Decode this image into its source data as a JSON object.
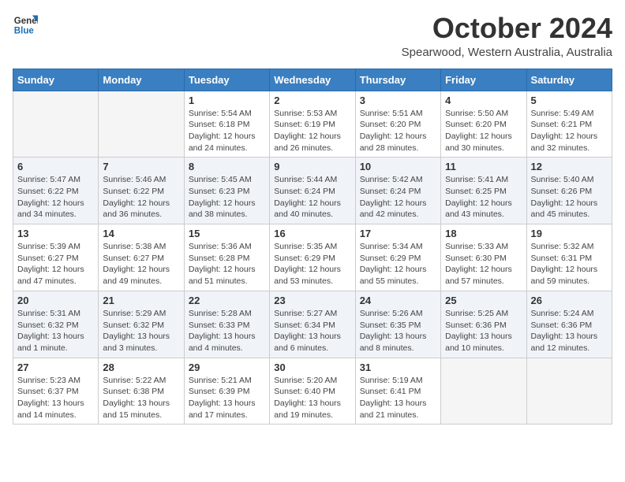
{
  "logo": {
    "line1": "General",
    "line2": "Blue"
  },
  "title": "October 2024",
  "subtitle": "Spearwood, Western Australia, Australia",
  "days_of_week": [
    "Sunday",
    "Monday",
    "Tuesday",
    "Wednesday",
    "Thursday",
    "Friday",
    "Saturday"
  ],
  "weeks": [
    [
      {
        "num": "",
        "info": ""
      },
      {
        "num": "",
        "info": ""
      },
      {
        "num": "1",
        "info": "Sunrise: 5:54 AM\nSunset: 6:18 PM\nDaylight: 12 hours and 24 minutes."
      },
      {
        "num": "2",
        "info": "Sunrise: 5:53 AM\nSunset: 6:19 PM\nDaylight: 12 hours and 26 minutes."
      },
      {
        "num": "3",
        "info": "Sunrise: 5:51 AM\nSunset: 6:20 PM\nDaylight: 12 hours and 28 minutes."
      },
      {
        "num": "4",
        "info": "Sunrise: 5:50 AM\nSunset: 6:20 PM\nDaylight: 12 hours and 30 minutes."
      },
      {
        "num": "5",
        "info": "Sunrise: 5:49 AM\nSunset: 6:21 PM\nDaylight: 12 hours and 32 minutes."
      }
    ],
    [
      {
        "num": "6",
        "info": "Sunrise: 5:47 AM\nSunset: 6:22 PM\nDaylight: 12 hours and 34 minutes."
      },
      {
        "num": "7",
        "info": "Sunrise: 5:46 AM\nSunset: 6:22 PM\nDaylight: 12 hours and 36 minutes."
      },
      {
        "num": "8",
        "info": "Sunrise: 5:45 AM\nSunset: 6:23 PM\nDaylight: 12 hours and 38 minutes."
      },
      {
        "num": "9",
        "info": "Sunrise: 5:44 AM\nSunset: 6:24 PM\nDaylight: 12 hours and 40 minutes."
      },
      {
        "num": "10",
        "info": "Sunrise: 5:42 AM\nSunset: 6:24 PM\nDaylight: 12 hours and 42 minutes."
      },
      {
        "num": "11",
        "info": "Sunrise: 5:41 AM\nSunset: 6:25 PM\nDaylight: 12 hours and 43 minutes."
      },
      {
        "num": "12",
        "info": "Sunrise: 5:40 AM\nSunset: 6:26 PM\nDaylight: 12 hours and 45 minutes."
      }
    ],
    [
      {
        "num": "13",
        "info": "Sunrise: 5:39 AM\nSunset: 6:27 PM\nDaylight: 12 hours and 47 minutes."
      },
      {
        "num": "14",
        "info": "Sunrise: 5:38 AM\nSunset: 6:27 PM\nDaylight: 12 hours and 49 minutes."
      },
      {
        "num": "15",
        "info": "Sunrise: 5:36 AM\nSunset: 6:28 PM\nDaylight: 12 hours and 51 minutes."
      },
      {
        "num": "16",
        "info": "Sunrise: 5:35 AM\nSunset: 6:29 PM\nDaylight: 12 hours and 53 minutes."
      },
      {
        "num": "17",
        "info": "Sunrise: 5:34 AM\nSunset: 6:29 PM\nDaylight: 12 hours and 55 minutes."
      },
      {
        "num": "18",
        "info": "Sunrise: 5:33 AM\nSunset: 6:30 PM\nDaylight: 12 hours and 57 minutes."
      },
      {
        "num": "19",
        "info": "Sunrise: 5:32 AM\nSunset: 6:31 PM\nDaylight: 12 hours and 59 minutes."
      }
    ],
    [
      {
        "num": "20",
        "info": "Sunrise: 5:31 AM\nSunset: 6:32 PM\nDaylight: 13 hours and 1 minute."
      },
      {
        "num": "21",
        "info": "Sunrise: 5:29 AM\nSunset: 6:32 PM\nDaylight: 13 hours and 3 minutes."
      },
      {
        "num": "22",
        "info": "Sunrise: 5:28 AM\nSunset: 6:33 PM\nDaylight: 13 hours and 4 minutes."
      },
      {
        "num": "23",
        "info": "Sunrise: 5:27 AM\nSunset: 6:34 PM\nDaylight: 13 hours and 6 minutes."
      },
      {
        "num": "24",
        "info": "Sunrise: 5:26 AM\nSunset: 6:35 PM\nDaylight: 13 hours and 8 minutes."
      },
      {
        "num": "25",
        "info": "Sunrise: 5:25 AM\nSunset: 6:36 PM\nDaylight: 13 hours and 10 minutes."
      },
      {
        "num": "26",
        "info": "Sunrise: 5:24 AM\nSunset: 6:36 PM\nDaylight: 13 hours and 12 minutes."
      }
    ],
    [
      {
        "num": "27",
        "info": "Sunrise: 5:23 AM\nSunset: 6:37 PM\nDaylight: 13 hours and 14 minutes."
      },
      {
        "num": "28",
        "info": "Sunrise: 5:22 AM\nSunset: 6:38 PM\nDaylight: 13 hours and 15 minutes."
      },
      {
        "num": "29",
        "info": "Sunrise: 5:21 AM\nSunset: 6:39 PM\nDaylight: 13 hours and 17 minutes."
      },
      {
        "num": "30",
        "info": "Sunrise: 5:20 AM\nSunset: 6:40 PM\nDaylight: 13 hours and 19 minutes."
      },
      {
        "num": "31",
        "info": "Sunrise: 5:19 AM\nSunset: 6:41 PM\nDaylight: 13 hours and 21 minutes."
      },
      {
        "num": "",
        "info": ""
      },
      {
        "num": "",
        "info": ""
      }
    ]
  ]
}
